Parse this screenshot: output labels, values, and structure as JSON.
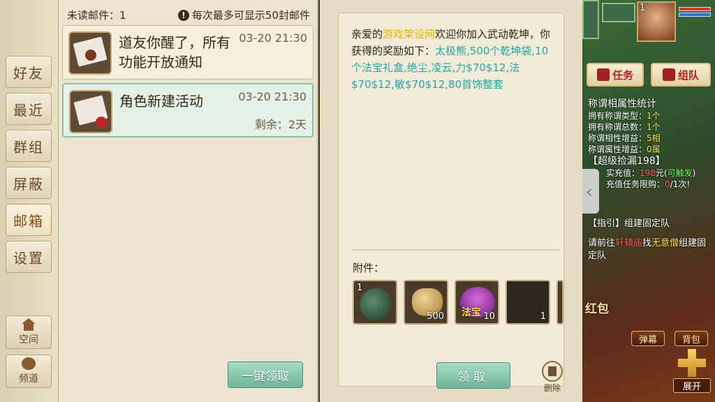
{
  "tabs": [
    "好友",
    "最近",
    "群组",
    "屏蔽",
    "邮箱",
    "设置"
  ],
  "mini_tabs": [
    {
      "label": "空间",
      "icon": "house-icon"
    },
    {
      "label": "频道",
      "icon": "chat-bubble-icon"
    }
  ],
  "list": {
    "unread": "未读邮件：1",
    "limit": "每次最多可显示50封邮件",
    "mails": [
      {
        "subject": "道友你醒了，所有功能开放通知",
        "date": "03-20 21:30",
        "remaining": ""
      },
      {
        "subject": "角色新建活动",
        "date": "03-20 21:30",
        "remaining": "剩余：2天"
      }
    ],
    "claim_all": "一键领取"
  },
  "detail": {
    "body_prefix": "亲爱的",
    "body_site": "游戏架设网",
    "body_mid": "欢迎你加入武动乾坤，你获得的奖励如下：",
    "body_rewards": "太极熊,500个乾坤袋,10个法宝礼盒,绝尘,凌云,力$70$12,法$70$12,敏$70$12,80首饰整套",
    "attachments_label": "附件：",
    "slots": [
      {
        "count": "",
        "corner": "1"
      },
      {
        "count": "500",
        "corner": ""
      },
      {
        "count": "10",
        "corner": "",
        "text": "法宝"
      },
      {
        "count": "1",
        "corner": ""
      }
    ],
    "claim": "领取",
    "delete": "删除"
  },
  "hud": {
    "level": "1",
    "quest": "任务",
    "team": "组队",
    "stats_title": "称谓相属性统计",
    "stats": [
      {
        "label": "拥有称谓类型：",
        "value": "1个"
      },
      {
        "label": "拥有称谓总数：",
        "value": "1个"
      },
      {
        "label": "称谓相性增益：",
        "value": "5相"
      },
      {
        "label": "称谓属性增益：",
        "value": "0属"
      }
    ],
    "event": "【超级捡漏198】",
    "recharge_label": "实充值：",
    "recharge_value": "198",
    "recharge_unit": "元(",
    "recharge_trigger": "可触发",
    "recharge_end": ")",
    "task_label": "充值任务限购：",
    "task_value": "0",
    "task_total": "/1次!",
    "guide_title": "【指引】组建固定队",
    "guide_pre": "请前往",
    "guide_loc": "轩辕庙",
    "guide_mid": "找",
    "guide_npc": "无意僧",
    "guide_post": "组建固定队",
    "red_packet": "红包",
    "barrage": "弹幕",
    "bag": "背包",
    "expand": "展开"
  }
}
